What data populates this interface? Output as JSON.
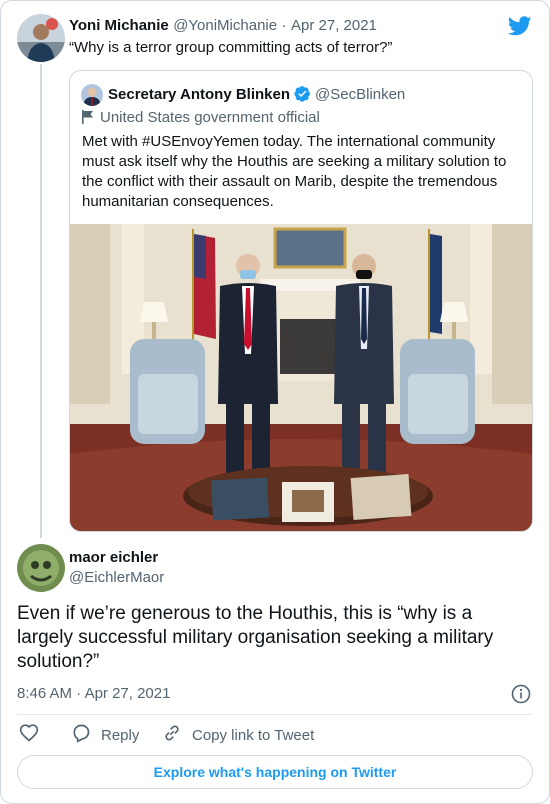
{
  "original_tweet": {
    "author_name": "Yoni Michanie",
    "handle": "@YoniMichanie",
    "separator": "·",
    "date": "Apr 27, 2021",
    "text": "“Why is a terror group committing acts of terror?”"
  },
  "quoted_tweet": {
    "author_name": "Secretary Antony Blinken",
    "handle": "@SecBlinken",
    "label": "United States government official",
    "text": "Met with #USEnvoyYemen today. The international community must ask itself why the Houthis are seeking a military solution to the conflict with their assault on Marib, despite the tremendous humanitarian consequences."
  },
  "reply": {
    "author_name": "maor eichler",
    "handle": "@EichlerMaor",
    "text": "Even if we’re generous to the Houthis, this is “why is a largely successful military organisation seeking a military solution?”",
    "time": "8:46 AM",
    "separator": "·",
    "date": "Apr 27, 2021"
  },
  "actions": {
    "reply_label": "Reply",
    "copy_label": "Copy link to Tweet"
  },
  "footer": {
    "explore_label": "Explore what's happening on Twitter"
  },
  "icons": {
    "brand": "twitter-bird-icon",
    "verified": "verified-badge-icon",
    "gov_label": "flag-icon",
    "info": "info-icon",
    "like": "heart-icon",
    "reply": "reply-icon",
    "copy": "link-icon"
  },
  "colors": {
    "twitter_blue": "#1d9bf0",
    "text": "#0f1419",
    "muted": "#536471",
    "border": "#cfd9de"
  }
}
